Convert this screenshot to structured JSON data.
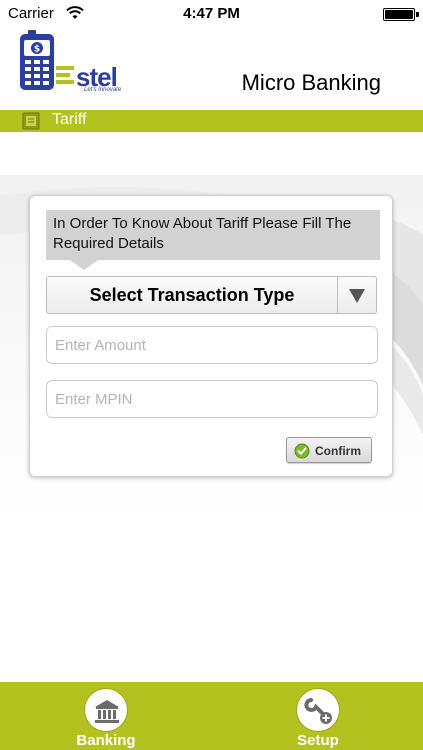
{
  "status_bar": {
    "carrier": "Carrier",
    "time": "4:47 PM"
  },
  "header": {
    "logo_text": "stel",
    "logo_tagline": "Let's Innovate",
    "title": "Micro Banking"
  },
  "section": {
    "label": "Tariff"
  },
  "form": {
    "info_text": "In Order To Know About Tariff Please Fill The Required Details",
    "select_label": "Select Transaction Type",
    "amount_placeholder": "Enter Amount",
    "mpin_placeholder": "Enter MPIN",
    "confirm_label": "Confirm"
  },
  "tabs": [
    {
      "label": "Banking",
      "icon": "bank-icon"
    },
    {
      "label": "Setup",
      "icon": "tools-icon"
    }
  ],
  "colors": {
    "accent": "#b3c21e",
    "logo_blue": "#2c3f9e",
    "info_box": "#d2d2d2"
  }
}
